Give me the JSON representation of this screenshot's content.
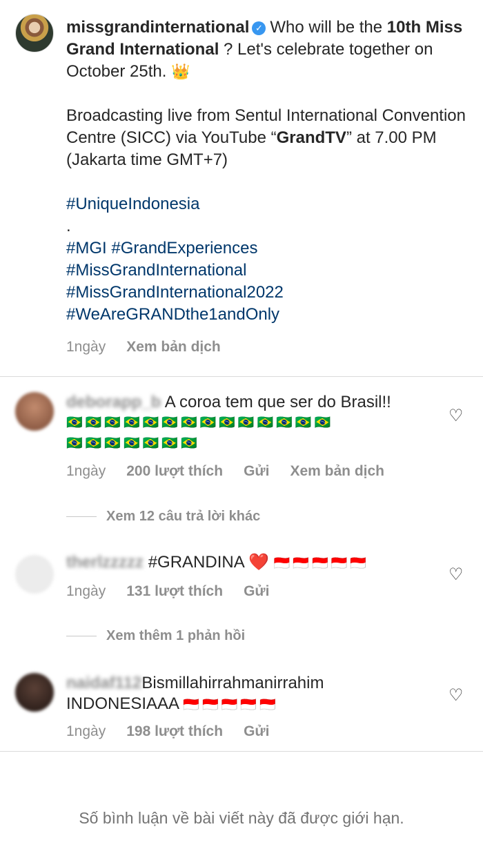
{
  "post": {
    "username": "missgrandinternational",
    "caption_line1_a": "Who will be the ",
    "caption_line1_b": "10th",
    "caption_line2_bold": "Miss Grand International",
    "caption_line2_rest": " ? Let's celebrate together on October 25th.",
    "crown_emoji": "👑",
    "broadcast_a": "Broadcasting live from Sentul International Convention Centre (SICC) via YouTube “",
    "broadcast_bold": "GrandTV",
    "broadcast_b": "” at 7.00 PM (Jakarta time GMT+7)",
    "hashtag1": "#UniqueIndonesia",
    "dot": ".",
    "hashtag2": "#MGI #GrandExperiences",
    "hashtag3": "#MissGrandInternational",
    "hashtag4": "#MissGrandInternational2022",
    "hashtag5": "#WeAreGRANDthe1andOnly",
    "time": "1ngày",
    "translate": "Xem bản dịch"
  },
  "comments": [
    {
      "username": "deborapp_b",
      "text": "A coroa tem que ser do Brasil!!",
      "flags_line1": "🇧🇷🇧🇷🇧🇷🇧🇷🇧🇷🇧🇷🇧🇷🇧🇷🇧🇷🇧🇷🇧🇷🇧🇷🇧🇷🇧🇷",
      "flags_line2": "🇧🇷🇧🇷🇧🇷🇧🇷🇧🇷🇧🇷🇧🇷",
      "time": "1ngày",
      "likes": "200 lượt thích",
      "reply": "Gửi",
      "translate": "Xem bản dịch",
      "view_replies": "Xem 12 câu trả lời khác",
      "avatar_color": "#a06a50"
    },
    {
      "username": "therlzzzzz",
      "text": "#GRANDINA",
      "heart_emoji": "❤️",
      "flags": "🇮🇩🇮🇩🇮🇩🇮🇩🇮🇩",
      "time": "1ngày",
      "likes": "131 lượt thích",
      "reply": "Gửi",
      "view_replies": "Xem thêm 1 phản hồi",
      "avatar_color": "#e6e6e6"
    },
    {
      "username": "naidaf112",
      "text": "Bismillahirrahmanirrahim",
      "text2": "INDONESIAAA",
      "flags": "🇮🇩🇮🇩🇮🇩🇮🇩🇮🇩",
      "time": "1ngày",
      "likes": "198 lượt thích",
      "reply": "Gửi",
      "avatar_color": "#3b2a24"
    }
  ],
  "footer": {
    "limited_notice": "Số bình luận về bài viết này đã được giới hạn."
  },
  "icons": {
    "verified": "verified-badge-icon",
    "heart": "heart-outline-icon"
  },
  "colors": {
    "hashtag": "#00376b",
    "meta_gray": "#8e8e8e",
    "verified_blue": "#3897f0"
  }
}
